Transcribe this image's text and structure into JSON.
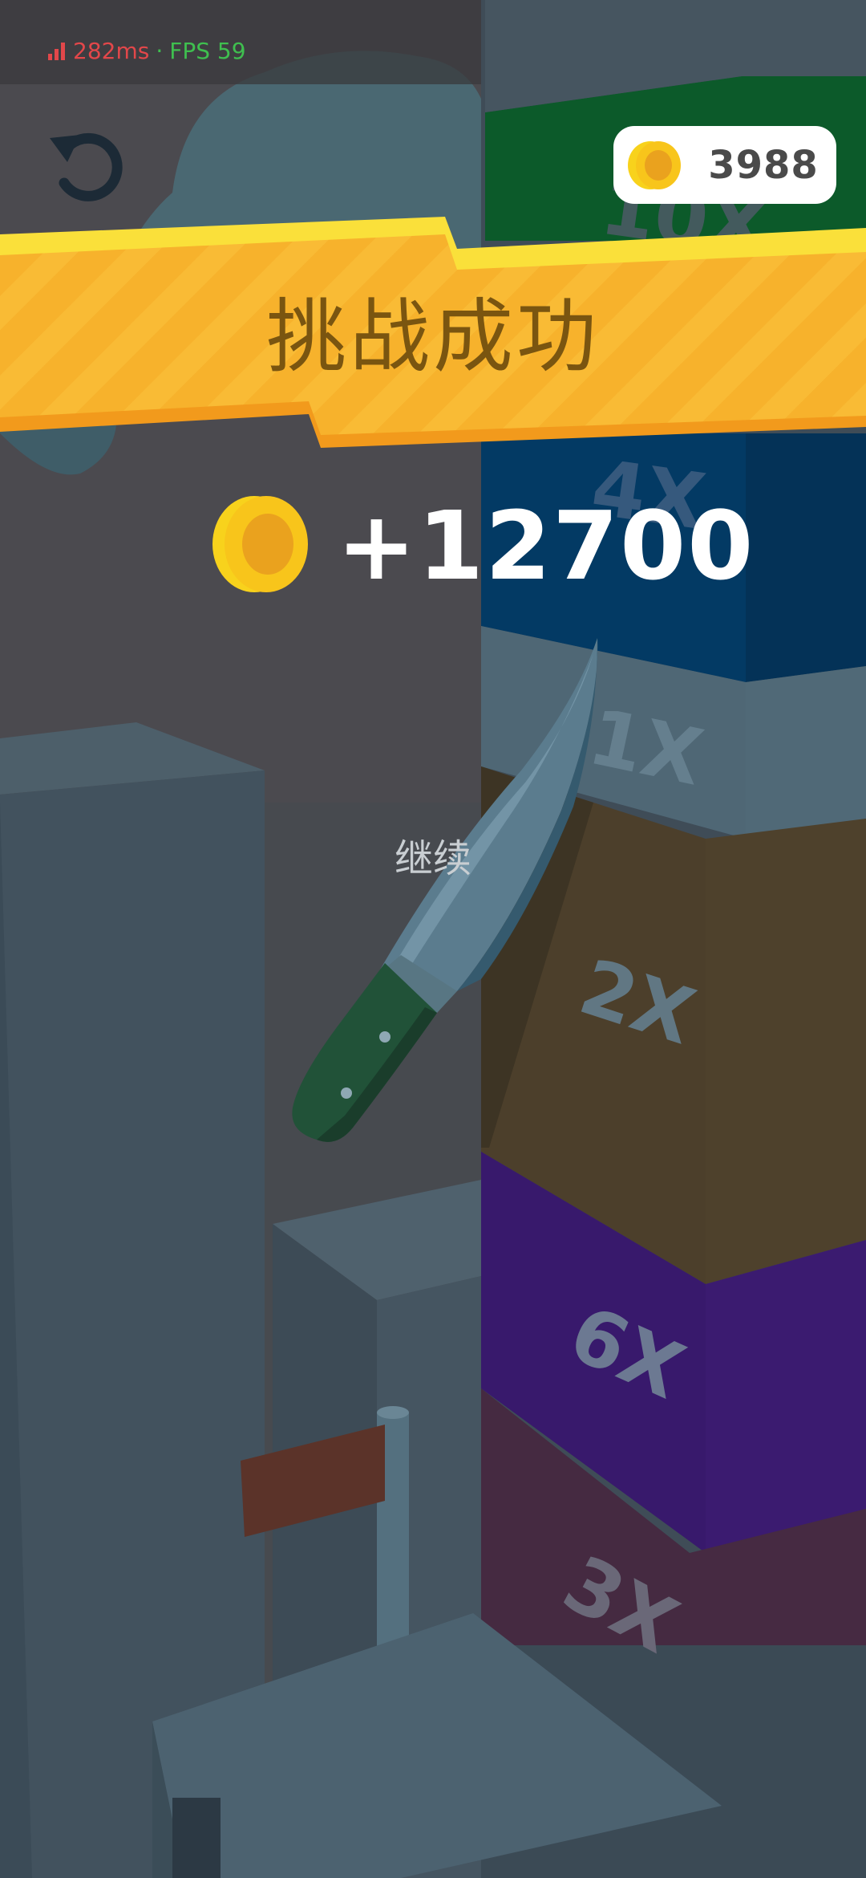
{
  "status": {
    "latency": "282ms",
    "separator": "·",
    "fps": "FPS 59",
    "latency_color": "#e2474a",
    "fps_color": "#3fbf4f"
  },
  "toolbar": {
    "restart_icon": "restart-icon"
  },
  "coins": {
    "total": "3988",
    "icon": "coin-icon"
  },
  "banner": {
    "title": "挑战成功"
  },
  "reward": {
    "amount": "+12700",
    "icon": "coin-icon"
  },
  "actions": {
    "continue_label": "继续"
  },
  "tower": {
    "multipliers": [
      "10X",
      "4X",
      "1X",
      "2X",
      "6X",
      "3X"
    ],
    "colors": {
      "10X": "#0c5a2a",
      "4X": "#033a64",
      "1X": "#4f6775",
      "2X": "#4c3f2b",
      "6X": "#38196c",
      "3X": "#452a41"
    }
  },
  "colors": {
    "banner_yellow": "#f7b22c",
    "banner_highlight": "#fae03a",
    "banner_text": "#7a5510",
    "coin_gold": "#f8c51b",
    "coin_inner": "#eaa21e"
  }
}
